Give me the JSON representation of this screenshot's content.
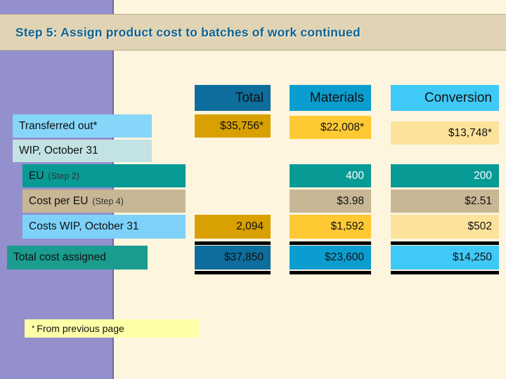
{
  "slide": {
    "title": "Step 5: Assign product cost to batches of work continued",
    "background_color": "#FDF5DE",
    "sidebar_color": "#9490CD",
    "title_bar_color": "#E0D4B4",
    "title_text_color": "#11628F"
  },
  "table": {
    "column_headers": [
      {
        "label": "Total",
        "color": "#0D6D9C"
      },
      {
        "label": "Materials",
        "color": "#0C9DD0"
      },
      {
        "label": "Conversion",
        "color": "#3FC9F7"
      }
    ],
    "rows": [
      {
        "label": "Transferred out*",
        "label_color": "#86D6F9",
        "total": "$35,756*",
        "materials": "$22,008*",
        "conversion": "$13,748*",
        "cell_colors": [
          "#D8A000",
          "#FFC933",
          "#FCE29B"
        ]
      },
      {
        "label": "WIP, October 31",
        "label_color": "#C2E2E4",
        "total": "",
        "materials": "",
        "conversion": "",
        "cell_colors": [
          "",
          "",
          ""
        ]
      },
      {
        "label": "EU",
        "label_note": "(Step 2)",
        "label_color": "#089A95",
        "total": "",
        "materials": "400",
        "conversion": "200",
        "cell_colors": [
          "",
          "#089A95",
          "#089A95"
        ]
      },
      {
        "label": "Cost per EU",
        "label_note": "(Step 4)",
        "label_color": "#C8B795",
        "total": "",
        "materials": "$3.98",
        "conversion": "$2.51",
        "cell_colors": [
          "",
          "#C8B795",
          "#C8B795"
        ]
      },
      {
        "label": "Costs WIP, October 31",
        "label_color": "#7ED2FA",
        "total": "2,094",
        "materials": "$1,592",
        "conversion": "$502",
        "cell_colors": [
          "#D8A000",
          "#FFC933",
          "#FCE29B"
        ]
      },
      {
        "label": "Total cost assigned",
        "label_color": "#1A9C8F",
        "total": "$37,850",
        "materials": "$23,600",
        "conversion": "$14,250",
        "cell_colors": [
          "#0D6D9C",
          "#0C9DD0",
          "#3FC9F7"
        ]
      }
    ]
  },
  "footnote": {
    "marker": "*",
    "text": "From previous page",
    "background": "#FFFFA8"
  }
}
